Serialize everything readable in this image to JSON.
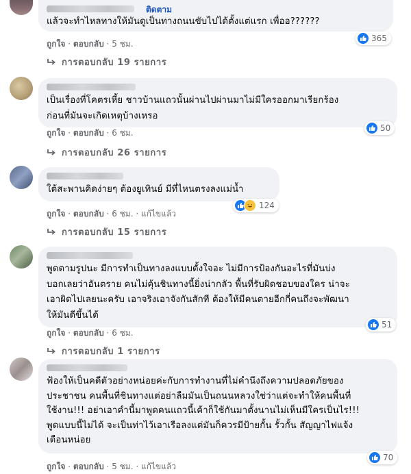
{
  "comments": [
    {
      "follow": "ติดตาม",
      "lines": [
        "แล้วจะทำไหลทางให้มันดูเป็นทางถนนขับไปได้ตั้งแต่แรก เพื่ออ??????"
      ],
      "reaction_count": "365",
      "like": "ถูกใจ",
      "reply": "ตอบกลับ",
      "time": "5 ชม.",
      "edited": "",
      "replies_label": "การตอบกลับ 19 รายการ"
    },
    {
      "follow": "",
      "lines": [
        "เป็นเรื่องที่โคตรเหี้ย ชาวบ้านแถวนั้นผ่านไปผ่านมาไม่มีใครออกมาเรียกร้อง",
        "ก่อนที่มันจะเกิดเหตุบ้างเหรอ"
      ],
      "reaction_count": "50",
      "like": "ถูกใจ",
      "reply": "ตอบกลับ",
      "time": "6 ชม.",
      "edited": "",
      "replies_label": "การตอบกลับ 26 รายการ"
    },
    {
      "follow": "",
      "lines": [
        "ใต้สะพานคิดง่ายๆ ต้องยูเทินย์ มีที่ไหนตรงลงแม่น้ำ"
      ],
      "reaction_count": "124",
      "like": "ถูกใจ",
      "reply": "ตอบกลับ",
      "time": "6 ชม.",
      "edited": "แก้ไขแล้ว",
      "replies_label": "การตอบกลับ 15 รายการ"
    },
    {
      "follow": "",
      "lines": [
        "พูดตามรูปนะ มีการทำเป็นทางลงแบบตั้งใจอะ ไม่มีการป้องกันอะไรที่มันบ่ง",
        "บอกเลยว่าอันตราย คนไม่คุ้นชินทางนี้ยิ่งน่ากลัว พื้นที่รับผิดชอบของใคร น่าจะ",
        "เอาผิดไปเลยนะครับ เอาจริงเอาจังกันสักที ต้องให้มีคนตายอีกกี่คนถึงจะพัฒนา",
        "ให้มันดีขึ้นได้"
      ],
      "reaction_count": "51",
      "like": "ถูกใจ",
      "reply": "ตอบกลับ",
      "time": "6 ชม.",
      "edited": "",
      "replies_label": "การตอบกลับ 1 รายการ"
    },
    {
      "follow": "",
      "lines": [
        "ฟ้องให้เป็นคดีตัวอย่างหน่อยค่ะกับการทำงานที่ไม่คำนึงถึงความปลอดภัยของ",
        "ประชาชน คนพื้นที่ชินทางแต่อย่าลืมมันเป็นถนนหลวงใช่ว่าแต่จะทำให้คนพื้นที่",
        "ใช้งาน!!! อย่าเอาคำนี้มาพูดคนแถวนี้เค้าก็ใช้กันมาตั้งนานไม่เห็นมีใครเป็นไร!!!",
        "พูดแบบนี้ไม่ได้ จะเป็นท่าไว้เอาเรือลงแต่มันก็ควรมีป้ายกั้น รั้วกั้น สัญญาไฟแจ้ง",
        "เตือนหน่อย"
      ],
      "reaction_count": "70",
      "like": "ถูกใจ",
      "reply": "ตอบกลับ",
      "time": "5 ชม.",
      "edited": "แก้ไขแล้ว",
      "replies_label": ""
    }
  ],
  "colors": {
    "bubble": "#f0f2f5",
    "like_blue": "#1877f2",
    "meta_gray": "#65676b"
  },
  "icons": {
    "reply_arrow": "reply-arrow-icon",
    "like": "like-icon",
    "haha": "haha-icon"
  }
}
